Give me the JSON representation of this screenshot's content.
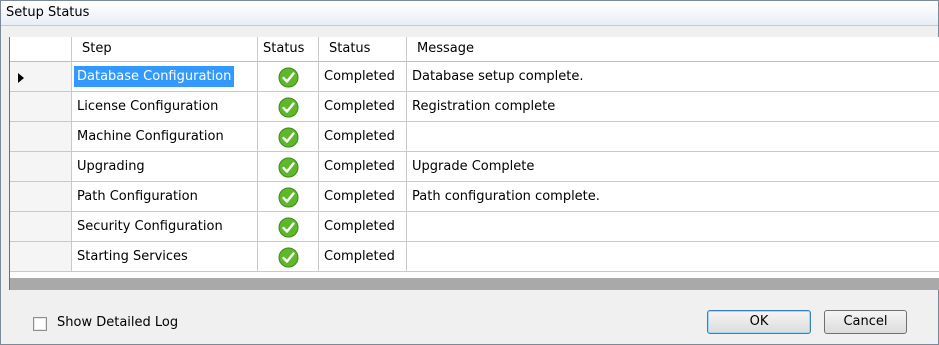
{
  "window": {
    "title": "Setup Status"
  },
  "grid": {
    "columns": [
      "Step",
      "Status",
      "Status",
      "Message"
    ],
    "rows": [
      {
        "step": "Database Configuration",
        "status_icon": "check-icon",
        "status": "Completed",
        "message": "Database setup complete."
      },
      {
        "step": "License Configuration",
        "status_icon": "check-icon",
        "status": "Completed",
        "message": "Registration complete"
      },
      {
        "step": "Machine Configuration",
        "status_icon": "check-icon",
        "status": "Completed",
        "message": ""
      },
      {
        "step": "Upgrading",
        "status_icon": "check-icon",
        "status": "Completed",
        "message": "Upgrade Complete"
      },
      {
        "step": "Path Configuration",
        "status_icon": "check-icon",
        "status": "Completed",
        "message": "Path configuration complete."
      },
      {
        "step": "Security Configuration",
        "status_icon": "check-icon",
        "status": "Completed",
        "message": ""
      },
      {
        "step": "Starting Services",
        "status_icon": "check-icon",
        "status": "Completed",
        "message": ""
      }
    ]
  },
  "footer": {
    "show_detailed_log_label": "Show Detailed Log",
    "show_detailed_log_checked": false,
    "ok_label": "OK",
    "cancel_label": "Cancel"
  }
}
